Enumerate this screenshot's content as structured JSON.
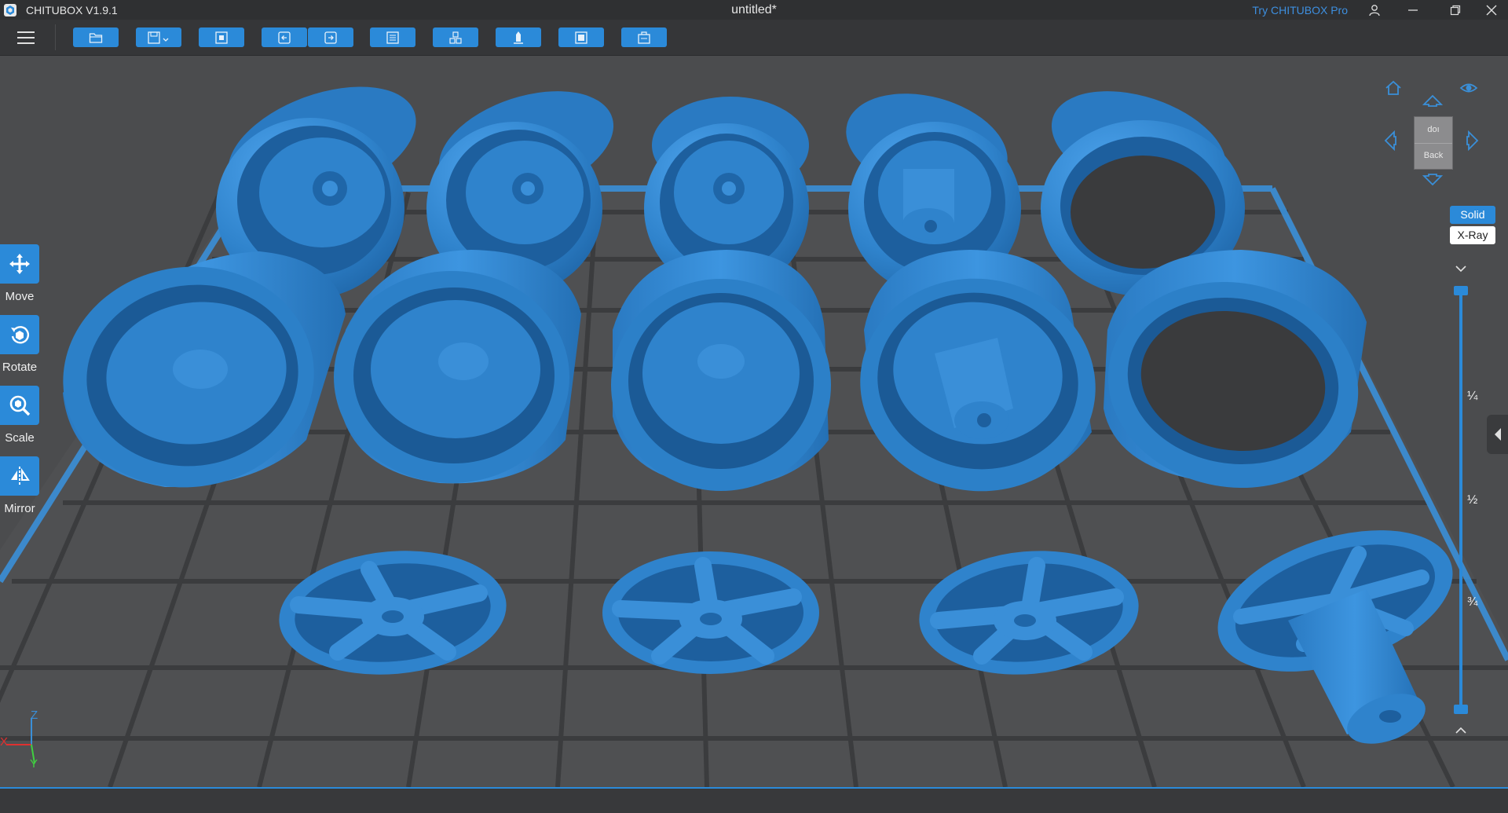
{
  "window": {
    "app_name": "CHITUBOX V1.9.1",
    "title": "untitled*",
    "try_pro": "Try CHITUBOX Pro"
  },
  "toolbar": {
    "buttons": [
      {
        "name": "open-file-button",
        "icon": "folder-icon"
      },
      {
        "name": "save-button",
        "icon": "save-icon"
      },
      {
        "name": "auto-layout-button",
        "icon": "layout-icon"
      },
      {
        "name": "undo-button",
        "icon": "undo-icon"
      },
      {
        "name": "redo-button",
        "icon": "redo-icon"
      },
      {
        "name": "model-list-button",
        "icon": "list-icon"
      },
      {
        "name": "group-button",
        "icon": "group-icon"
      },
      {
        "name": "support-button",
        "icon": "support-icon"
      },
      {
        "name": "slice-button",
        "icon": "slice-icon"
      },
      {
        "name": "export-button",
        "icon": "export-icon"
      }
    ]
  },
  "tools": {
    "move": "Move",
    "rotate": "Rotate",
    "scale": "Scale",
    "mirror": "Mirror"
  },
  "view": {
    "cube_top": "doı",
    "cube_front": "Back",
    "solid": "Solid",
    "xray": "X-Ray",
    "slider_ticks": [
      "¼",
      "½",
      "¾"
    ]
  },
  "axis": {
    "z": "Z",
    "x": "X",
    "y": "Y"
  },
  "colors": {
    "accent": "#2b8ad9",
    "model": "#3a8fd8",
    "plate": "#4b4c4e",
    "grid": "#3a3b3d"
  }
}
